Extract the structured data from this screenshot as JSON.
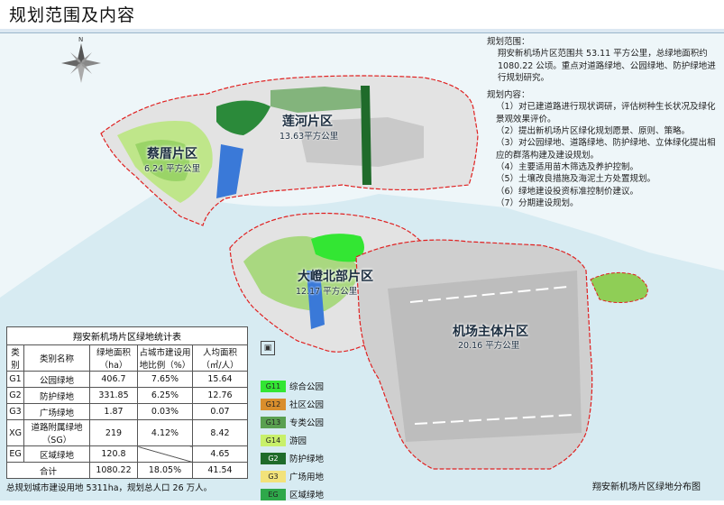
{
  "page": {
    "title": "规划范围及内容"
  },
  "districts": [
    {
      "id": "caicuo",
      "name": "蔡厝片区",
      "area": "6.24 平方公里"
    },
    {
      "id": "lianhe",
      "name": "莲河片区",
      "area": "13.63平方公里"
    },
    {
      "id": "dadeng",
      "name": "大嶝北部片区",
      "area": "12.17 平方公里"
    },
    {
      "id": "airport",
      "name": "机场主体片区",
      "area": "20.16 平方公里"
    }
  ],
  "description": {
    "scope_heading": "规划范围：",
    "scope_text": "翔安新机场片区范围共 53.11 平方公里，总绿地面积约 1080.22 公顷。重点对道路绿地、公园绿地、防护绿地进行规划研究。",
    "content_heading": "规划内容：",
    "content_items": [
      "（1）对已建道路进行现状调研，评估树种生长状况及绿化景观效果评价。",
      "（2）提出新机场片区绿化规划愿景、原则、策略。",
      "（3）对公园绿地、道路绿地、防护绿地、立体绿化提出相应的群落构建及建设规划。",
      "（4）主要适用苗木筛选及养护控制。",
      "（5）土壤改良措施及海泥土方处置规划。",
      "（6）绿地建设投资标准控制价建议。",
      "（7）分期建设规划。"
    ]
  },
  "table": {
    "title": "翔安新机场片区绿地统计表",
    "headers": [
      "类别",
      "类别名称",
      "绿地面积（ha）",
      "占城市建设用地比例（%）",
      "人均面积（㎡/人）"
    ],
    "rows": [
      [
        "G1",
        "公园绿地",
        "406.7",
        "7.65%",
        "15.64"
      ],
      [
        "G2",
        "防护绿地",
        "331.85",
        "6.25%",
        "12.76"
      ],
      [
        "G3",
        "广场绿地",
        "1.87",
        "0.03%",
        "0.07"
      ],
      [
        "XG",
        "道路附属绿地（SG）",
        "219",
        "4.12%",
        "8.42"
      ],
      [
        "EG",
        "区域绿地",
        "120.8",
        "",
        "4.65"
      ]
    ],
    "total": [
      "合计",
      "1080.22",
      "18.05%",
      "41.54"
    ],
    "footnote": "总规划城市建设用地 5311ha，规划总人口 26 万人。"
  },
  "legend": [
    {
      "code": "G11",
      "label": "综合公园",
      "color": "#33e633"
    },
    {
      "code": "G12",
      "label": "社区公园",
      "color": "#d98e2c"
    },
    {
      "code": "G13",
      "label": "专类公园",
      "color": "#5aa050"
    },
    {
      "code": "G14",
      "label": "游园",
      "color": "#c8f06a"
    },
    {
      "code": "G2",
      "label": "防护绿地",
      "color": "#1f6b2a"
    },
    {
      "code": "G3",
      "label": "广场用地",
      "color": "#f2e27a"
    },
    {
      "code": "EG",
      "label": "区域绿地",
      "color": "#2ea84a"
    }
  ],
  "map": {
    "caption": "翔安新机场片区绿地分布图",
    "north_icon": "compass-rose-icon",
    "scale_icon": "scale-icon"
  },
  "colors": {
    "sea": "#cfe6ee",
    "land": "#e6e6e6",
    "boundary": "#e02020",
    "water": "#3a79d8"
  }
}
